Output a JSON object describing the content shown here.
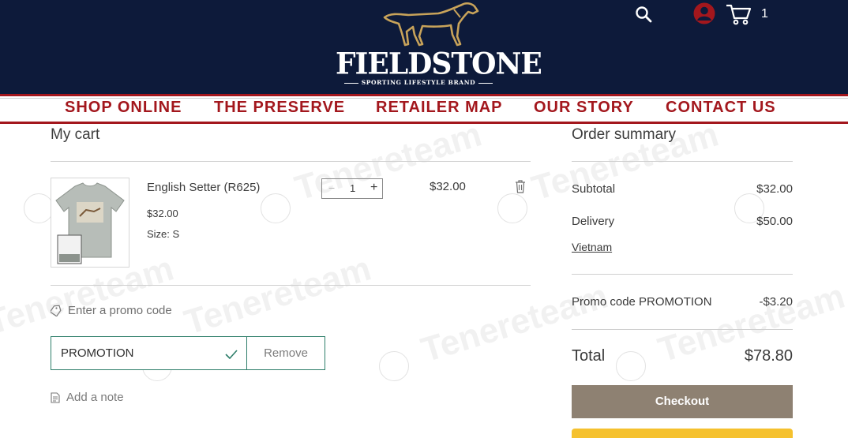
{
  "header": {
    "brand_name": "FIELDSTONE",
    "brand_tagline": "SPORTING LIFESTYLE BRAND",
    "cart_count": "1",
    "icons": [
      "search-icon",
      "account-icon",
      "cart-icon"
    ]
  },
  "nav": {
    "items": [
      {
        "label": "SHOP ONLINE"
      },
      {
        "label": "THE PRESERVE"
      },
      {
        "label": "RETAILER MAP"
      },
      {
        "label": "OUR STORY"
      },
      {
        "label": "CONTACT US"
      }
    ]
  },
  "cart": {
    "title": "My cart",
    "item": {
      "name": "English Setter (R625)",
      "unit_price": "$32.00",
      "size": "Size: S",
      "quantity": "1",
      "minus": "−",
      "plus": "+",
      "line_total": "$32.00"
    },
    "promo": {
      "link_label": "Enter a promo code",
      "code_value": "PROMOTION",
      "remove_label": "Remove"
    },
    "note_label": "Add a note"
  },
  "summary": {
    "title": "Order summary",
    "subtotal_label": "Subtotal",
    "subtotal_value": "$32.00",
    "delivery_label": "Delivery",
    "delivery_value": "$50.00",
    "delivery_country": "Vietnam",
    "promo_label": "Promo code PROMOTION",
    "promo_value": "-$3.20",
    "total_label": "Total",
    "total_value": "$78.80",
    "checkout_label": "Checkout"
  },
  "watermark": "Tenereteam",
  "colors": {
    "header_bg": "#0d1a3a",
    "nav_accent": "#a3171d",
    "promo_border": "#2e7e6a",
    "checkout_bg": "#8e8172",
    "paypal_yellow": "#f5c12e"
  }
}
